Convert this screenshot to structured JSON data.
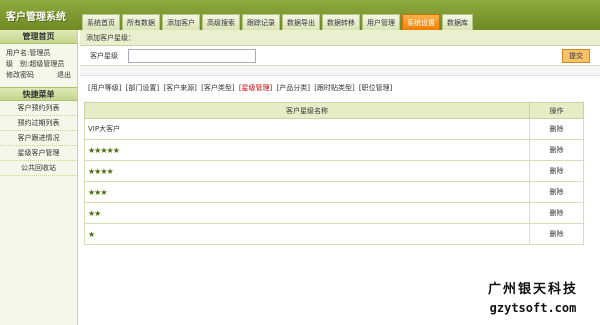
{
  "app": {
    "title": "客户管理系统"
  },
  "nav": {
    "tabs": [
      {
        "label": "系统首页",
        "active": false
      },
      {
        "label": "所有数据",
        "active": false
      },
      {
        "label": "添加客户",
        "active": false
      },
      {
        "label": "高级搜索",
        "active": false
      },
      {
        "label": "跟踪记录",
        "active": false
      },
      {
        "label": "数据导出",
        "active": false
      },
      {
        "label": "数据转移",
        "active": false
      },
      {
        "label": "用户管理",
        "active": false
      },
      {
        "label": "系统设置",
        "active": true
      },
      {
        "label": "数据库",
        "active": false
      }
    ],
    "active_color": "#f07c00"
  },
  "sidebar": {
    "header": "管理首页",
    "username_line": "用户名:管理员",
    "level_line": "级　别:超级管理员",
    "change_password": "修改密码",
    "logout": "退出",
    "menu_header": "快捷菜单",
    "items": [
      "客户预约列表",
      "预约过期列表",
      "客户跟进情况",
      "星级客户管理",
      "公共回收站"
    ]
  },
  "main": {
    "subbar_title": "添加客户星级：",
    "form_label": "客户星级",
    "input_value": "",
    "submit_label": "提交",
    "sublinks": [
      "[用户等级]",
      "[部门设置]",
      "[客户来源]",
      "[客户类型]",
      "[星级管理]",
      "[产品分类]",
      "[跟时贴类型]",
      "[职位管理]"
    ],
    "current_sublink_index": 4,
    "table": {
      "headers": [
        "客户星级名称",
        "操作"
      ],
      "rows": [
        {
          "name": "VIP大客户",
          "stars": 0,
          "action": "删除"
        },
        {
          "name": "",
          "stars": 5,
          "action": "删除"
        },
        {
          "name": "",
          "stars": 4,
          "action": "删除"
        },
        {
          "name": "",
          "stars": 3,
          "action": "删除"
        },
        {
          "name": "",
          "stars": 2,
          "action": "删除"
        },
        {
          "name": "",
          "stars": 1,
          "action": "删除"
        }
      ]
    }
  },
  "watermark": {
    "line1": "广州银天科技",
    "line2": "gzytsoft.com"
  },
  "colors": {
    "accent_green": "#6f8a24",
    "star_color": "#4a6a08",
    "current_link": "#cc0000"
  }
}
